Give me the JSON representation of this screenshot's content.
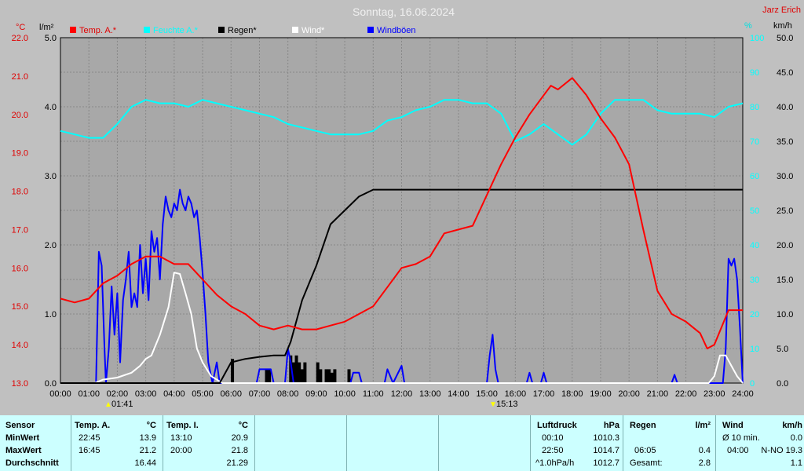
{
  "title": "Sonntag, 16.06.2024",
  "author": "Jarz Erich",
  "units": {
    "temp": "°C",
    "rain": "l/m²",
    "hum": "%",
    "wind": "km/h"
  },
  "legend": [
    {
      "label": "Temp. A.*",
      "color": "#ff0000"
    },
    {
      "label": "Feuchte A.*",
      "color": "#00ffff"
    },
    {
      "label": "Regen*",
      "color": "#000000"
    },
    {
      "label": "Wind*",
      "color": "#ffffff"
    },
    {
      "label": "Windböen",
      "color": "#0000ff"
    }
  ],
  "markers": {
    "sunrise": "01:41",
    "sunset": "15:13"
  },
  "chart_data": {
    "type": "line",
    "x_unit": "hours",
    "x_ticks": [
      "00:00",
      "01:00",
      "02:00",
      "03:00",
      "04:00",
      "05:00",
      "06:00",
      "07:00",
      "08:00",
      "09:00",
      "10:00",
      "11:00",
      "12:00",
      "13:00",
      "14:00",
      "15:00",
      "16:00",
      "17:00",
      "18:00",
      "19:00",
      "20:00",
      "21:00",
      "22:00",
      "23:00",
      "24:00"
    ],
    "axes": {
      "temp": {
        "min": 13.0,
        "max": 22.0,
        "ticks": [
          "13.0",
          "14.0",
          "15.0",
          "16.0",
          "17.0",
          "18.0",
          "19.0",
          "20.0",
          "21.0",
          "22.0"
        ]
      },
      "rain": {
        "min": 0.0,
        "max": 5.0,
        "ticks": [
          "0.0",
          "1.0",
          "2.0",
          "3.0",
          "4.0",
          "5.0"
        ]
      },
      "hum": {
        "min": 0,
        "max": 100,
        "ticks": [
          "0",
          "10",
          "20",
          "30",
          "40",
          "50",
          "60",
          "70",
          "80",
          "90",
          "100"
        ]
      },
      "wind": {
        "min": 0.0,
        "max": 50.0,
        "ticks": [
          "0.0",
          "5.0",
          "10.0",
          "15.0",
          "20.0",
          "25.0",
          "30.0",
          "35.0",
          "40.0",
          "45.0",
          "50.0"
        ]
      }
    },
    "grid": true,
    "series": [
      {
        "name": "Temp. A.*",
        "axis": "temp",
        "color": "#ff0000",
        "points": [
          [
            0,
            15.2
          ],
          [
            0.5,
            15.1
          ],
          [
            1,
            15.2
          ],
          [
            1.5,
            15.6
          ],
          [
            2,
            15.8
          ],
          [
            2.5,
            16.1
          ],
          [
            3,
            16.3
          ],
          [
            3.5,
            16.3
          ],
          [
            4,
            16.1
          ],
          [
            4.5,
            16.1
          ],
          [
            5,
            15.7
          ],
          [
            5.5,
            15.3
          ],
          [
            6,
            15.0
          ],
          [
            6.5,
            14.8
          ],
          [
            7,
            14.5
          ],
          [
            7.5,
            14.4
          ],
          [
            8,
            14.5
          ],
          [
            8.5,
            14.4
          ],
          [
            9,
            14.4
          ],
          [
            9.5,
            14.5
          ],
          [
            10,
            14.6
          ],
          [
            10.5,
            14.8
          ],
          [
            11,
            15.0
          ],
          [
            11.5,
            15.5
          ],
          [
            12,
            16.0
          ],
          [
            12.5,
            16.1
          ],
          [
            13,
            16.3
          ],
          [
            13.5,
            16.9
          ],
          [
            14,
            17.0
          ],
          [
            14.5,
            17.1
          ],
          [
            15,
            17.9
          ],
          [
            15.5,
            18.7
          ],
          [
            16,
            19.4
          ],
          [
            16.5,
            20.0
          ],
          [
            17,
            20.5
          ],
          [
            17.25,
            20.75
          ],
          [
            17.5,
            20.65
          ],
          [
            18,
            20.95
          ],
          [
            18.5,
            20.5
          ],
          [
            19,
            19.9
          ],
          [
            19.5,
            19.4
          ],
          [
            20,
            18.7
          ],
          [
            20.5,
            17.0
          ],
          [
            21,
            15.4
          ],
          [
            21.5,
            14.8
          ],
          [
            22,
            14.6
          ],
          [
            22.5,
            14.3
          ],
          [
            22.75,
            13.9
          ],
          [
            23,
            14.0
          ],
          [
            23.5,
            14.9
          ],
          [
            24,
            14.9
          ]
        ]
      },
      {
        "name": "Feuchte A.*",
        "axis": "hum",
        "color": "#00ffff",
        "points": [
          [
            0,
            73
          ],
          [
            0.5,
            72
          ],
          [
            1,
            71
          ],
          [
            1.5,
            71
          ],
          [
            2,
            75
          ],
          [
            2.5,
            80
          ],
          [
            3,
            82
          ],
          [
            3.5,
            81
          ],
          [
            4,
            81
          ],
          [
            4.5,
            80
          ],
          [
            5,
            82
          ],
          [
            5.5,
            81
          ],
          [
            6,
            80
          ],
          [
            6.5,
            79
          ],
          [
            7,
            78
          ],
          [
            7.5,
            77
          ],
          [
            8,
            75
          ],
          [
            8.5,
            74
          ],
          [
            9,
            73
          ],
          [
            9.5,
            72
          ],
          [
            10,
            72
          ],
          [
            10.5,
            72
          ],
          [
            11,
            73
          ],
          [
            11.5,
            76
          ],
          [
            12,
            77
          ],
          [
            12.5,
            79
          ],
          [
            13,
            80
          ],
          [
            13.5,
            82
          ],
          [
            14,
            82
          ],
          [
            14.5,
            81
          ],
          [
            15,
            81
          ],
          [
            15.5,
            78
          ],
          [
            16,
            70
          ],
          [
            16.5,
            72
          ],
          [
            17,
            75
          ],
          [
            17.5,
            72
          ],
          [
            18,
            69
          ],
          [
            18.5,
            72
          ],
          [
            19,
            78
          ],
          [
            19.5,
            82
          ],
          [
            20,
            82
          ],
          [
            20.5,
            82
          ],
          [
            21,
            79
          ],
          [
            21.5,
            78
          ],
          [
            22,
            78
          ],
          [
            22.5,
            78
          ],
          [
            23,
            77
          ],
          [
            23.5,
            80
          ],
          [
            24,
            81
          ]
        ]
      },
      {
        "name": "Regen*",
        "axis": "rain",
        "color": "#000000",
        "points": [
          [
            0,
            0
          ],
          [
            5.6,
            0
          ],
          [
            6.0,
            0.3
          ],
          [
            6.5,
            0.35
          ],
          [
            7,
            0.38
          ],
          [
            7.5,
            0.4
          ],
          [
            7.9,
            0.4
          ],
          [
            8.1,
            0.6
          ],
          [
            8.5,
            1.2
          ],
          [
            9,
            1.7
          ],
          [
            9.5,
            2.3
          ],
          [
            10,
            2.5
          ],
          [
            10.5,
            2.7
          ],
          [
            11,
            2.8
          ],
          [
            24,
            2.8
          ]
        ]
      },
      {
        "name": "Wind*",
        "axis": "wind",
        "color": "#ffffff",
        "points": [
          [
            0,
            0
          ],
          [
            1.2,
            0
          ],
          [
            1.5,
            0.5
          ],
          [
            2,
            0.8
          ],
          [
            2.5,
            1.5
          ],
          [
            2.8,
            2.5
          ],
          [
            3,
            3.5
          ],
          [
            3.2,
            4
          ],
          [
            3.5,
            7
          ],
          [
            3.8,
            11
          ],
          [
            4,
            16
          ],
          [
            4.2,
            15.8
          ],
          [
            4.4,
            13
          ],
          [
            4.6,
            10
          ],
          [
            4.8,
            5
          ],
          [
            5.0,
            3
          ],
          [
            5.3,
            1
          ],
          [
            5.7,
            0
          ],
          [
            22.8,
            0
          ],
          [
            23,
            1
          ],
          [
            23.2,
            4
          ],
          [
            23.4,
            4
          ],
          [
            23.6,
            2.5
          ],
          [
            23.8,
            1
          ],
          [
            24,
            0
          ]
        ]
      },
      {
        "name": "Windböen",
        "axis": "wind",
        "color": "#0000ff",
        "points": [
          [
            0,
            0
          ],
          [
            1.25,
            0
          ],
          [
            1.35,
            19
          ],
          [
            1.45,
            17
          ],
          [
            1.55,
            5
          ],
          [
            1.6,
            0
          ],
          [
            1.7,
            5
          ],
          [
            1.8,
            14
          ],
          [
            1.9,
            7
          ],
          [
            2.0,
            13
          ],
          [
            2.1,
            3
          ],
          [
            2.2,
            12
          ],
          [
            2.3,
            15
          ],
          [
            2.4,
            19
          ],
          [
            2.5,
            11
          ],
          [
            2.6,
            13
          ],
          [
            2.7,
            11
          ],
          [
            2.8,
            20
          ],
          [
            2.9,
            13
          ],
          [
            3.0,
            18
          ],
          [
            3.1,
            12
          ],
          [
            3.2,
            22
          ],
          [
            3.3,
            19
          ],
          [
            3.4,
            21
          ],
          [
            3.5,
            15
          ],
          [
            3.6,
            23
          ],
          [
            3.7,
            27
          ],
          [
            3.8,
            25
          ],
          [
            3.9,
            24
          ],
          [
            4.0,
            26
          ],
          [
            4.1,
            25
          ],
          [
            4.2,
            28
          ],
          [
            4.3,
            26
          ],
          [
            4.4,
            25
          ],
          [
            4.5,
            27
          ],
          [
            4.6,
            26
          ],
          [
            4.7,
            24
          ],
          [
            4.8,
            25
          ],
          [
            4.9,
            21
          ],
          [
            5.0,
            16
          ],
          [
            5.1,
            10
          ],
          [
            5.2,
            3
          ],
          [
            5.35,
            0
          ],
          [
            5.5,
            3
          ],
          [
            5.6,
            0
          ],
          [
            6.9,
            0
          ],
          [
            7.0,
            2
          ],
          [
            7.4,
            2
          ],
          [
            7.5,
            0
          ],
          [
            7.9,
            0
          ],
          [
            8.0,
            5
          ],
          [
            8.1,
            3
          ],
          [
            8.2,
            0
          ],
          [
            10.2,
            0
          ],
          [
            10.3,
            1.5
          ],
          [
            10.5,
            1.5
          ],
          [
            10.6,
            0
          ],
          [
            11.4,
            0
          ],
          [
            11.5,
            2
          ],
          [
            11.7,
            0
          ],
          [
            12.0,
            2.5
          ],
          [
            12.1,
            0
          ],
          [
            15.0,
            0
          ],
          [
            15.1,
            4
          ],
          [
            15.2,
            7
          ],
          [
            15.3,
            2
          ],
          [
            15.4,
            0
          ],
          [
            16.4,
            0
          ],
          [
            16.5,
            1.5
          ],
          [
            16.6,
            0
          ],
          [
            16.9,
            0
          ],
          [
            17.0,
            1.5
          ],
          [
            17.1,
            0
          ],
          [
            21.5,
            0
          ],
          [
            21.6,
            1.2
          ],
          [
            21.7,
            0
          ],
          [
            23.3,
            0
          ],
          [
            23.4,
            5
          ],
          [
            23.5,
            18
          ],
          [
            23.6,
            17
          ],
          [
            23.7,
            18
          ],
          [
            23.8,
            15
          ],
          [
            23.9,
            8
          ],
          [
            24,
            0
          ]
        ]
      }
    ],
    "rain_bars": {
      "axis": "rain",
      "bars": [
        [
          6.05,
          0.35
        ],
        [
          7.25,
          0.2
        ],
        [
          7.35,
          0.2
        ],
        [
          8.1,
          0.4
        ],
        [
          8.2,
          0.3
        ],
        [
          8.3,
          0.4
        ],
        [
          8.4,
          0.3
        ],
        [
          8.5,
          0.2
        ],
        [
          8.6,
          0.3
        ],
        [
          9.05,
          0.3
        ],
        [
          9.15,
          0.2
        ],
        [
          9.35,
          0.2
        ],
        [
          9.45,
          0.2
        ],
        [
          9.55,
          0.15
        ],
        [
          9.65,
          0.2
        ],
        [
          10.15,
          0.2
        ]
      ]
    }
  },
  "stats": {
    "sensor": {
      "header": "Sensor",
      "rows": [
        "MinWert",
        "MaxWert",
        "Durchschnitt"
      ]
    },
    "temp_a": {
      "header": "Temp. A.",
      "unit": "°C",
      "times": [
        "22:45",
        "16:45",
        ""
      ],
      "values": [
        "13.9",
        "21.2",
        "16.44"
      ]
    },
    "temp_i": {
      "header": "Temp. I.",
      "unit": "°C",
      "times": [
        "13:10",
        "20:00",
        ""
      ],
      "values": [
        "20.9",
        "21.8",
        "21.29"
      ]
    },
    "luftdruck": {
      "header": "Luftdruck",
      "unit": "hPa",
      "times": [
        "00:10",
        "22:50",
        "^1.0hPa/h"
      ],
      "values": [
        "1010.3",
        "1014.7",
        "1012.7"
      ]
    },
    "regen": {
      "header": "Regen",
      "unit": "l/m²",
      "times": [
        "",
        "06:05",
        "Gesamt:"
      ],
      "values": [
        "",
        "0.4",
        "2.8"
      ]
    },
    "wind": {
      "header": "Wind",
      "unit": "km/h",
      "times": [
        "Ø 10 min.",
        "04:00",
        ""
      ],
      "values": [
        "0.0",
        "N-NO 19.3",
        "1.1"
      ]
    }
  }
}
